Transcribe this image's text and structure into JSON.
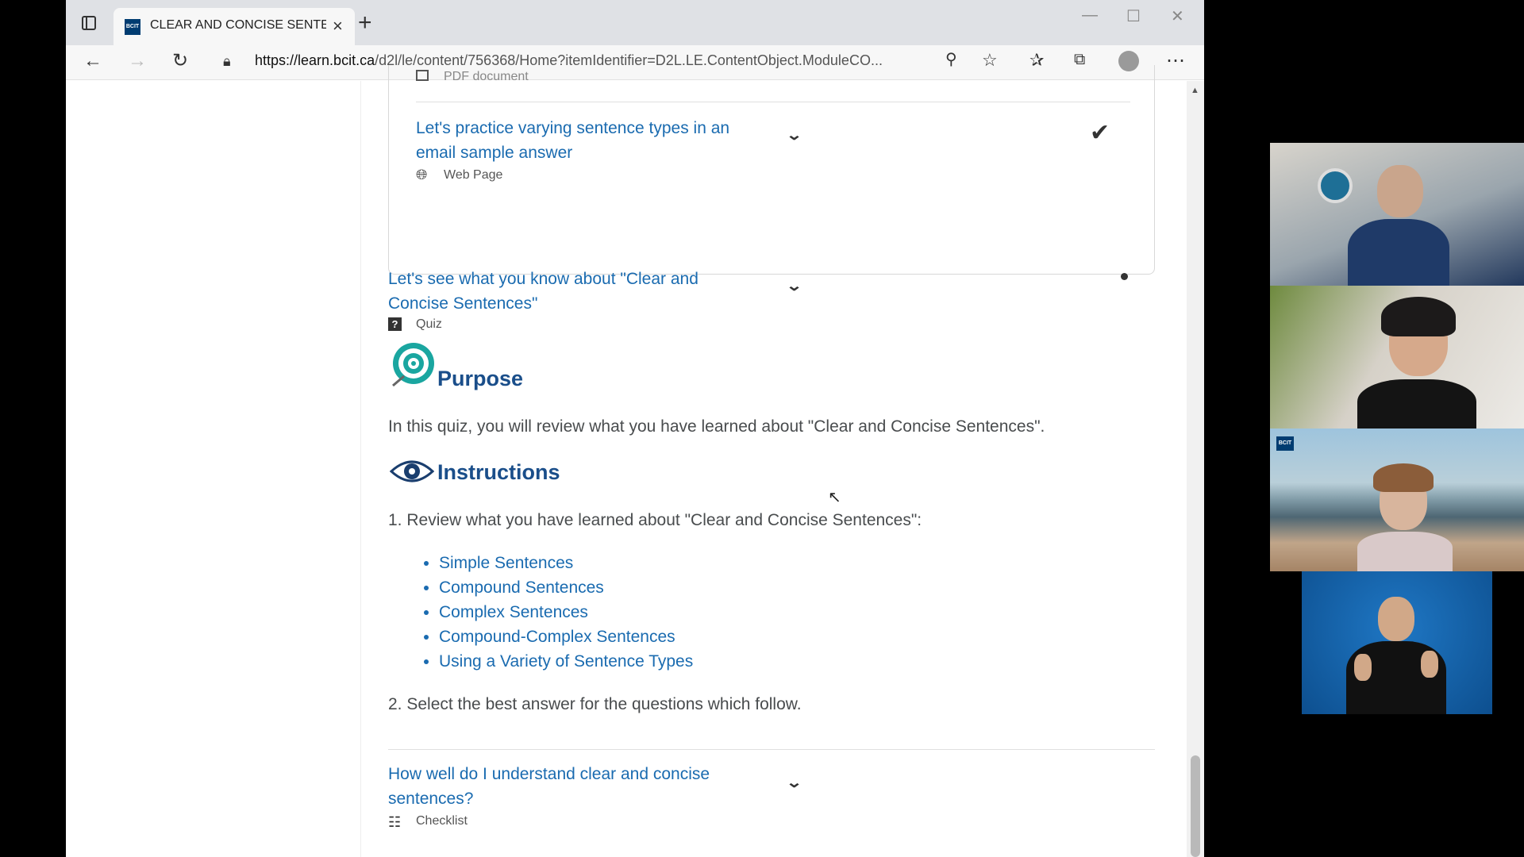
{
  "browser": {
    "tab_title": "CLEAR AND CONCISE SENTENCES",
    "tab_icon_label": "BCIT",
    "url_domain": "https://learn.bcit.ca",
    "url_path": "/d2l/le/content/756368/Home?itemIdentifier=D2L.LE.ContentObject.ModuleCO..."
  },
  "content": {
    "partial_item_type": "PDF document",
    "item1": {
      "title": "Let's practice varying sentence types in an email sample answer",
      "type": "Web Page"
    },
    "item2": {
      "title": "Let's see what you know about \"Clear and Concise Sentences\"",
      "type": "Quiz"
    },
    "purpose": {
      "heading": "Purpose",
      "text": "In this quiz, you will review what you have learned about \"Clear and Concise Sentences\"."
    },
    "instructions": {
      "heading": "Instructions",
      "step1": "1. Review what you have learned about \"Clear and Concise Sentences\":",
      "links": [
        "Simple Sentences",
        "Compound Sentences",
        "Complex Sentences",
        "Compound-Complex Sentences",
        "Using a Variety of Sentence Types"
      ],
      "step2": "2. Select the best answer for the questions which follow."
    },
    "item3": {
      "title": "How well do I understand clear and concise sentences?",
      "type": "Checklist"
    }
  },
  "video": {
    "badge": "BCIT"
  },
  "colors": {
    "link": "#1a6bb0",
    "heading": "#1a4e8a",
    "accent_teal": "#1aa6a0"
  }
}
